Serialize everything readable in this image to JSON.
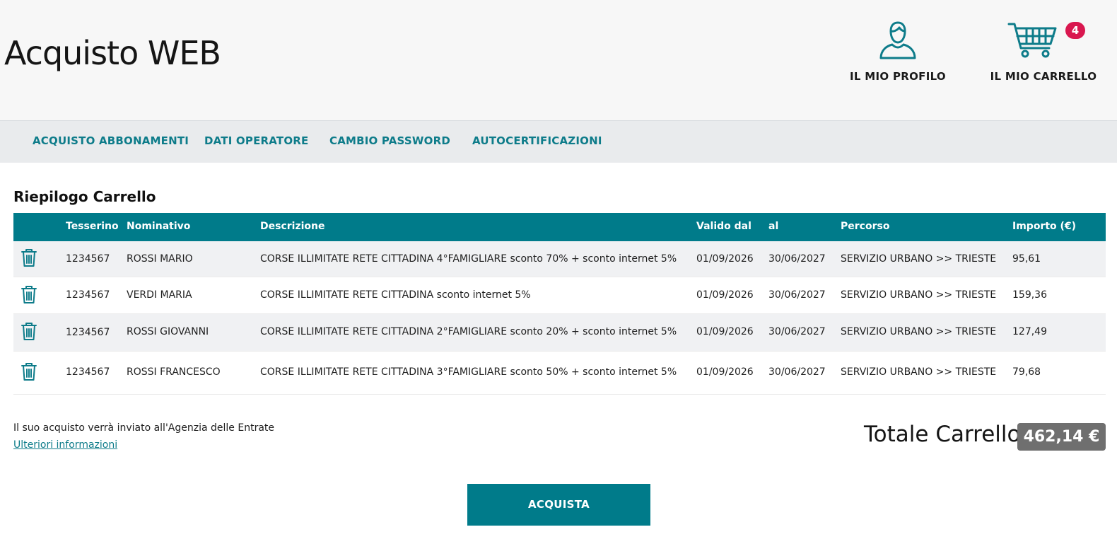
{
  "header": {
    "title": "Acquisto WEB",
    "profile_label": "IL MIO PROFILO",
    "cart_label": "IL MIO CARRELLO",
    "cart_count": "4",
    "accent_color": "#007b8a",
    "badge_color": "#d9174f"
  },
  "nav": {
    "items": [
      {
        "label": "ACQUISTO ABBONAMENTI"
      },
      {
        "label": "DATI OPERATORE"
      },
      {
        "label": "CAMBIO PASSWORD"
      },
      {
        "label": "AUTOCERTIFICAZIONI"
      }
    ]
  },
  "cart": {
    "title": "Riepilogo Carrello",
    "columns": [
      "Tesserino",
      "Nominativo",
      "Descrizione",
      "Valido dal",
      "al",
      "Percorso",
      "Importo (€)"
    ],
    "rows": [
      {
        "tesserino": "1234567",
        "nominativo": "ROSSI MARIO",
        "descrizione": "CORSE ILLIMITATE RETE CITTADINA 4°FAMIGLIARE sconto 70% + sconto internet 5%",
        "valido_dal": "01/09/2026",
        "al": "30/06/2027",
        "percorso": "SERVIZIO URBANO >> TRIESTE",
        "importo": "95,61"
      },
      {
        "tesserino": "1234567",
        "nominativo": "VERDI MARIA",
        "descrizione": "CORSE ILLIMITATE RETE CITTADINA sconto internet 5%",
        "valido_dal": "01/09/2026",
        "al": "30/06/2027",
        "percorso": "SERVIZIO URBANO >> TRIESTE",
        "importo": "159,36"
      },
      {
        "tesserino": "1234567",
        "nominativo": "ROSSI GIOVANNI",
        "descrizione": "CORSE ILLIMITATE RETE CITTADINA 2°FAMIGLIARE sconto 20% + sconto internet 5%",
        "valido_dal": "01/09/2026",
        "al": "30/06/2027",
        "percorso": "SERVIZIO URBANO >> TRIESTE",
        "importo": "127,49"
      },
      {
        "tesserino": "1234567",
        "nominativo": "ROSSI FRANCESCO",
        "descrizione": "CORSE ILLIMITATE RETE CITTADINA 3°FAMIGLIARE sconto 50% + sconto internet 5%",
        "valido_dal": "01/09/2026",
        "al": "30/06/2027",
        "percorso": "SERVIZIO URBANO >> TRIESTE",
        "importo": "79,68"
      }
    ],
    "row_icon": "trash-icon"
  },
  "footer": {
    "note": "Il suo acquisto verrà inviato all'Agenzia delle Entrate",
    "more_link": "Ulteriori informazioni",
    "total_label": "Totale Carrello",
    "total_value": "462,14 €",
    "buy_label": "ACQUISTA"
  }
}
